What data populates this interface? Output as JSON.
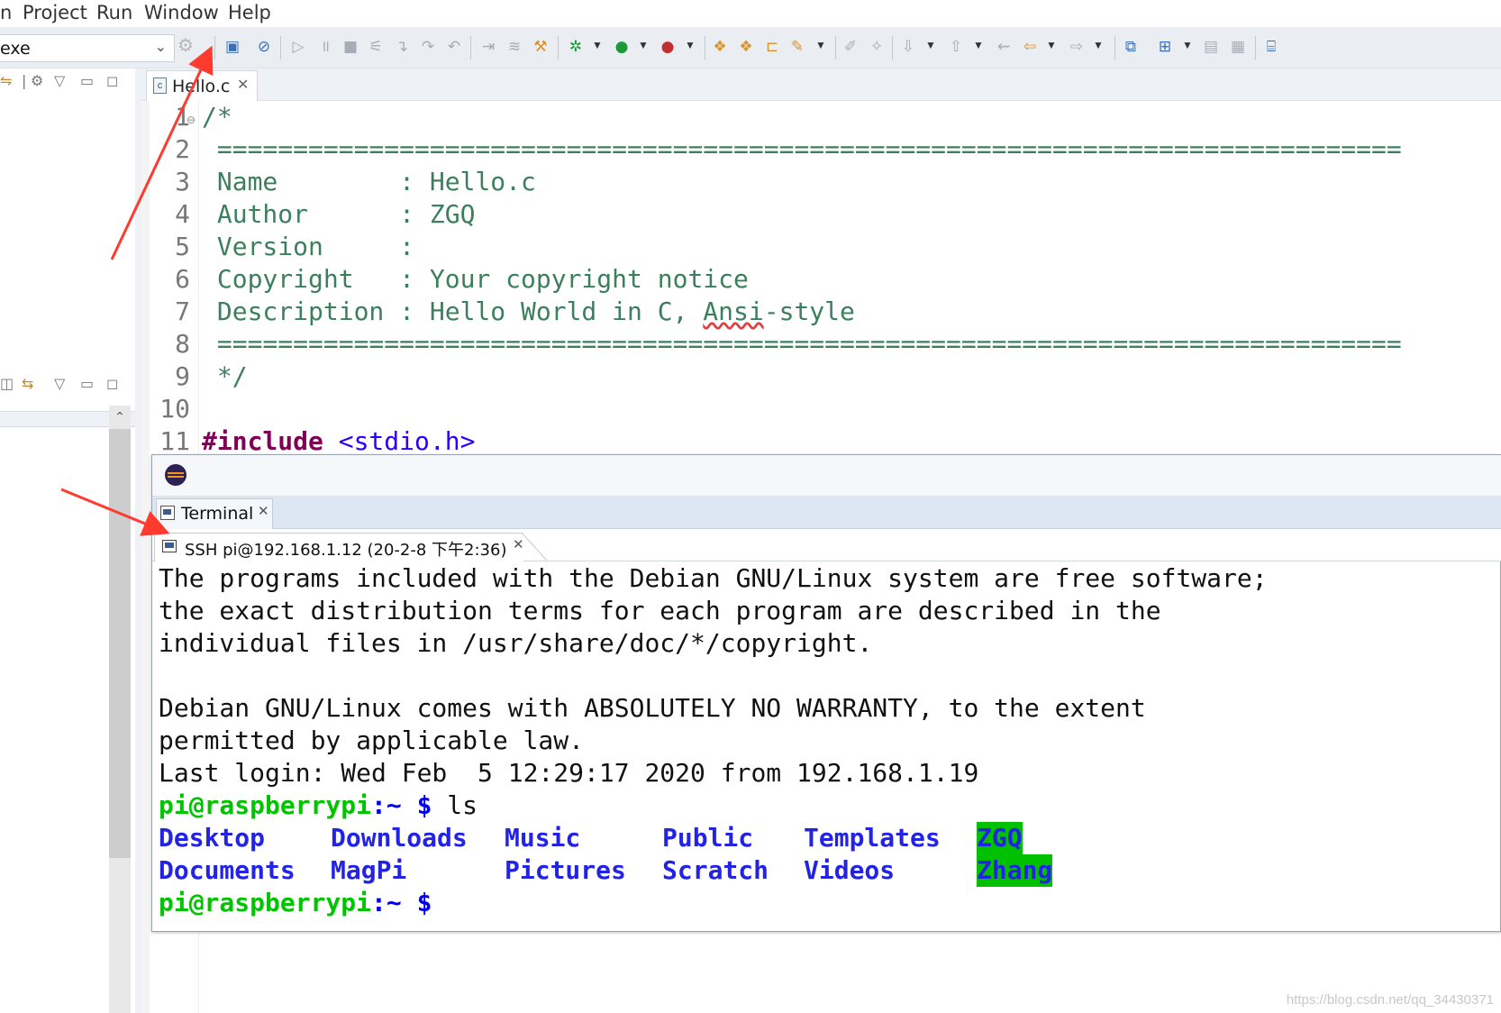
{
  "menubar": {
    "items": [
      "n",
      "Project",
      "Run",
      "Window",
      "Help"
    ]
  },
  "toolbar": {
    "launch_config": "exe",
    "icons": [
      "open-terminal-icon",
      "skip-breakpoints-icon",
      "resume-icon",
      "suspend-icon",
      "terminate-icon",
      "disconnect-icon",
      "step-into-icon",
      "step-over-icon",
      "step-return-icon",
      "drop-to-frame-icon",
      "use-step-filters-icon",
      "build-icon",
      "debug-icon",
      "run-icon",
      "external-tools-icon",
      "new-project-icon",
      "open-type-icon",
      "open-folder-icon",
      "search-icon",
      "edit-icon",
      "annotation-icon",
      "next-annotation-icon",
      "prev-annotation-icon",
      "last-edit-icon",
      "back-icon",
      "forward-icon",
      "new-window-icon",
      "perspective-icon",
      "save-icon",
      "save-all-icon",
      "binary-icon"
    ]
  },
  "editor": {
    "tab_label": "Hello.c",
    "line_numbers": [
      "1",
      "2",
      "3",
      "4",
      "5",
      "6",
      "7",
      "8",
      "9",
      "10",
      "11"
    ],
    "lines": {
      "l1": "/*",
      "l2": " ==============================================================================",
      "l3": " Name        : Hello.c",
      "l4": " Author      : ZGQ",
      "l5": " Version     :",
      "l6": " Copyright   : Your copyright notice",
      "l7a": " Description : Hello World in C, ",
      "l7b": "Ansi",
      "l7c": "-style",
      "l8": " ==============================================================================",
      "l9": " */",
      "l10": "",
      "l11a": "#include",
      "l11b": " <stdio.h>"
    }
  },
  "terminal": {
    "view_tab_label": "Terminal",
    "session_tab_label": "SSH pi@192.168.1.12 (20-2-8 下午2:36)",
    "lines": [
      "The programs included with the Debian GNU/Linux system are free software;",
      "the exact distribution terms for each program are described in the",
      "individual files in /usr/share/doc/*/copyright.",
      "",
      "Debian GNU/Linux comes with ABSOLUTELY NO WARRANTY, to the extent",
      "permitted by applicable law.",
      "Last login: Wed Feb  5 12:29:17 2020 from 192.168.1.19"
    ],
    "prompt": {
      "user_host": "pi@raspberrypi",
      "path": ":~",
      "sign": " $",
      "command": " ls"
    },
    "ls_row1": [
      "Desktop",
      "Downloads",
      "Music",
      "Public",
      "Templates",
      "ZGQ"
    ],
    "ls_row2": [
      "Documents",
      "MagPi",
      "Pictures",
      "Scratch",
      "Videos",
      "Zhang"
    ],
    "highlighted_dirs": [
      "ZGQ",
      "Zhang"
    ]
  },
  "colors": {
    "prompt_user": "#00c400",
    "dir_text": "#2323e6",
    "dir_highlight": "#00c000",
    "comment": "#3c7f5e",
    "keyword": "#7f0055",
    "annotation_arrow": "#ff3b2f"
  },
  "watermark": "https://blog.csdn.net/qq_34430371"
}
